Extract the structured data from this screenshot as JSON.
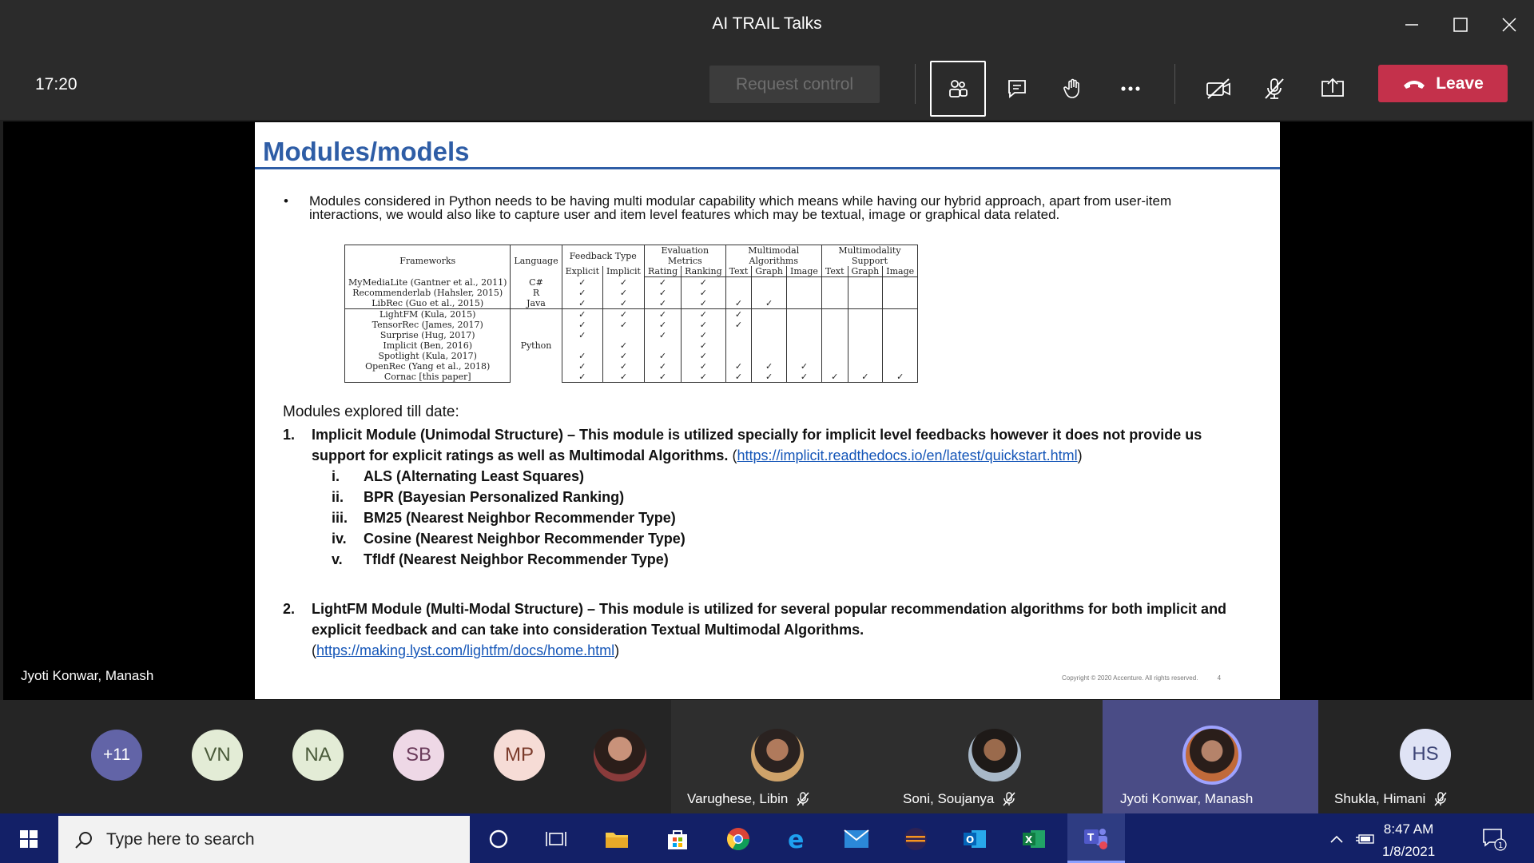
{
  "window": {
    "title": "AI TRAIL Talks"
  },
  "toolbar": {
    "time": "17:20",
    "request_control": "Request control",
    "leave": "Leave"
  },
  "slide": {
    "title": "Modules/models",
    "bullet": "Modules considered in Python needs to be having multi modular capability which means while having our hybrid approach, apart from user-item interactions, we would also like to capture user and item level features which may be textual, image or graphical data related.",
    "table": {
      "h_frameworks": "Frameworks",
      "h_language": "Language",
      "h_feedback": "Feedback Type",
      "h_evaluation": "Evaluation Metrics",
      "h_multimodal": "Multimodal Algorithms",
      "h_multimodality": "Multimodality Support",
      "h_explicit": "Explicit",
      "h_implicit": "Implicit",
      "h_rating": "Rating",
      "h_ranking": "Ranking",
      "h_text": "Text",
      "h_graph": "Graph",
      "h_image": "Image",
      "rows": [
        {
          "name": "MyMediaLite (Gantner et al., 2011)",
          "lang": "C#",
          "c": [
            "✓",
            "✓",
            "✓",
            "✓",
            "",
            "",
            "",
            "",
            "",
            ""
          ]
        },
        {
          "name": "Recommenderlab (Hahsler, 2015)",
          "lang": "R",
          "c": [
            "✓",
            "✓",
            "✓",
            "✓",
            "",
            "",
            "",
            "",
            "",
            ""
          ]
        },
        {
          "name": "LibRec (Guo et al., 2015)",
          "lang": "Java",
          "c": [
            "✓",
            "✓",
            "✓",
            "✓",
            "✓",
            "✓",
            "",
            "",
            "",
            ""
          ]
        },
        {
          "name": "LightFM (Kula, 2015)",
          "lang": "",
          "c": [
            "✓",
            "✓",
            "✓",
            "✓",
            "✓",
            "",
            "",
            "",
            "",
            ""
          ]
        },
        {
          "name": "TensorRec (James, 2017)",
          "lang": "",
          "c": [
            "✓",
            "✓",
            "✓",
            "✓",
            "✓",
            "",
            "",
            "",
            "",
            ""
          ]
        },
        {
          "name": "Surprise (Hug, 2017)",
          "lang": "",
          "c": [
            "✓",
            "",
            "✓",
            "✓",
            "",
            "",
            "",
            "",
            "",
            ""
          ]
        },
        {
          "name": "Implicit (Ben, 2016)",
          "lang": "Python",
          "c": [
            "",
            "✓",
            "",
            "✓",
            "",
            "",
            "",
            "",
            "",
            ""
          ]
        },
        {
          "name": "Spotlight (Kula, 2017)",
          "lang": "",
          "c": [
            "✓",
            "✓",
            "✓",
            "✓",
            "",
            "",
            "",
            "",
            "",
            ""
          ]
        },
        {
          "name": "OpenRec (Yang et al., 2018)",
          "lang": "",
          "c": [
            "✓",
            "✓",
            "✓",
            "✓",
            "✓",
            "✓",
            "✓",
            "",
            "",
            ""
          ]
        },
        {
          "name": "Cornac [this paper]",
          "lang": "",
          "c": [
            "✓",
            "✓",
            "✓",
            "✓",
            "✓",
            "✓",
            "✓",
            "✓",
            "✓",
            "✓"
          ]
        }
      ]
    },
    "explored_label": "Modules explored till date:",
    "item1": {
      "num": "1.",
      "text": "Implicit Module (Unimodal Structure) – This module is utilized specially for implicit level feedbacks however it does not provide us support for explicit ratings as well as Multimodal Algorithms.",
      "link": "https://implicit.readthedocs.io/en/latest/quickstart.html",
      "open": "(",
      "close": ")"
    },
    "sub_items": [
      {
        "roman": "i.",
        "text": "ALS (Alternating Least Squares)"
      },
      {
        "roman": "ii.",
        "text": "BPR (Bayesian Personalized Ranking)"
      },
      {
        "roman": "iii.",
        "text": "BM25 (Nearest Neighbor Recommender Type)"
      },
      {
        "roman": "iv.",
        "text": "Cosine (Nearest Neighbor Recommender Type)"
      },
      {
        "roman": "v.",
        "text": "TfIdf (Nearest Neighbor Recommender Type)"
      }
    ],
    "item2": {
      "num": "2.",
      "text": "LightFM Module (Multi-Modal Structure) – This module is utilized for several popular recommendation algorithms for both implicit and explicit feedback and can take into consideration Textual Multimodal Algorithms.",
      "link": "https://making.lyst.com/lightfm/docs/home.html",
      "open": "(",
      "close": ")"
    },
    "copyright": "Copyright © 2020 Accenture. All rights reserved.",
    "page": "4"
  },
  "presenter_label": "Jyoti Konwar, Manash",
  "participants": {
    "more": "+11",
    "initials": [
      {
        "t": "VN",
        "bg": "#e3ecd6",
        "fg": "#4a5a3a"
      },
      {
        "t": "NA",
        "bg": "#e3ecd6",
        "fg": "#4a5a3a"
      },
      {
        "t": "SB",
        "bg": "#eed8e6",
        "fg": "#6a3a5a"
      },
      {
        "t": "MP",
        "bg": "#f6dcd6",
        "fg": "#7a3a2a"
      }
    ],
    "tiles": [
      {
        "name": "Varughese, Libin"
      },
      {
        "name": "Soni, Soujanya"
      },
      {
        "name": "Jyoti Konwar, Manash"
      },
      {
        "name": "Shukla, Himani",
        "initials": "HS"
      }
    ]
  },
  "taskbar": {
    "search_placeholder": "Type here to search",
    "time": "8:47 AM",
    "date": "1/8/2021",
    "notif_count": "1"
  },
  "colors": {
    "accent": "#2e5da6",
    "leave": "#c4314b",
    "taskbar": "#132067"
  }
}
